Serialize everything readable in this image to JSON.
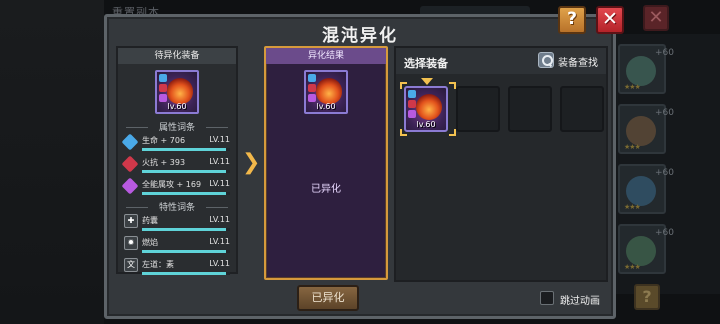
{
  "dialog": {
    "title": "混沌异化",
    "help_label": "?",
    "close_label": "✕"
  },
  "background": {
    "left_title": "重置副本",
    "close_label": "✕",
    "help_label": "?",
    "cards": [
      {
        "plus": "+60",
        "stars": "★★★",
        "color": "#4a7a6a"
      },
      {
        "plus": "+60",
        "stars": "★★★",
        "color": "#7a5a3a"
      },
      {
        "plus": "+60",
        "stars": "★★★",
        "color": "#3a6a8a"
      },
      {
        "plus": "+60",
        "stars": "★★★",
        "color": "#4a7a5a"
      }
    ]
  },
  "pending": {
    "header": "待异化装备",
    "item_level": "lv.60",
    "attributes_label": "属性词条",
    "attributes": [
      {
        "name": "生命 + 706",
        "level": "LV.11",
        "icon": "life-icon",
        "color": "#4aa9e8",
        "progress": 0.95
      },
      {
        "name": "火抗 + 393",
        "level": "LV.11",
        "icon": "fire-resist-icon",
        "color": "#d0384a",
        "progress": 0.95
      },
      {
        "name": "全能属攻 + 169",
        "level": "LV.11",
        "icon": "all-element-icon",
        "color": "#b85ae0",
        "progress": 0.95
      }
    ],
    "traits_label": "特性词条",
    "traits": [
      {
        "name": "药囊",
        "level": "LV.11",
        "icon": "potion-bag-icon",
        "glyph": "✚",
        "progress": 0.95
      },
      {
        "name": "燃焰",
        "level": "LV.11",
        "icon": "burning-flame-icon",
        "glyph": "✹",
        "progress": 0.95
      },
      {
        "name": "左道：素",
        "level": "LV.11",
        "icon": "left-path-icon",
        "glyph": "文",
        "progress": 0.95
      }
    ]
  },
  "result": {
    "header": "异化结果",
    "item_level": "lv.60",
    "status": "已异化"
  },
  "choose": {
    "title": "选择装备",
    "search_label": "装备查找",
    "selected_level": "lv.60"
  },
  "footer": {
    "done_label": "已异化",
    "skip_label": "跳过动画"
  }
}
